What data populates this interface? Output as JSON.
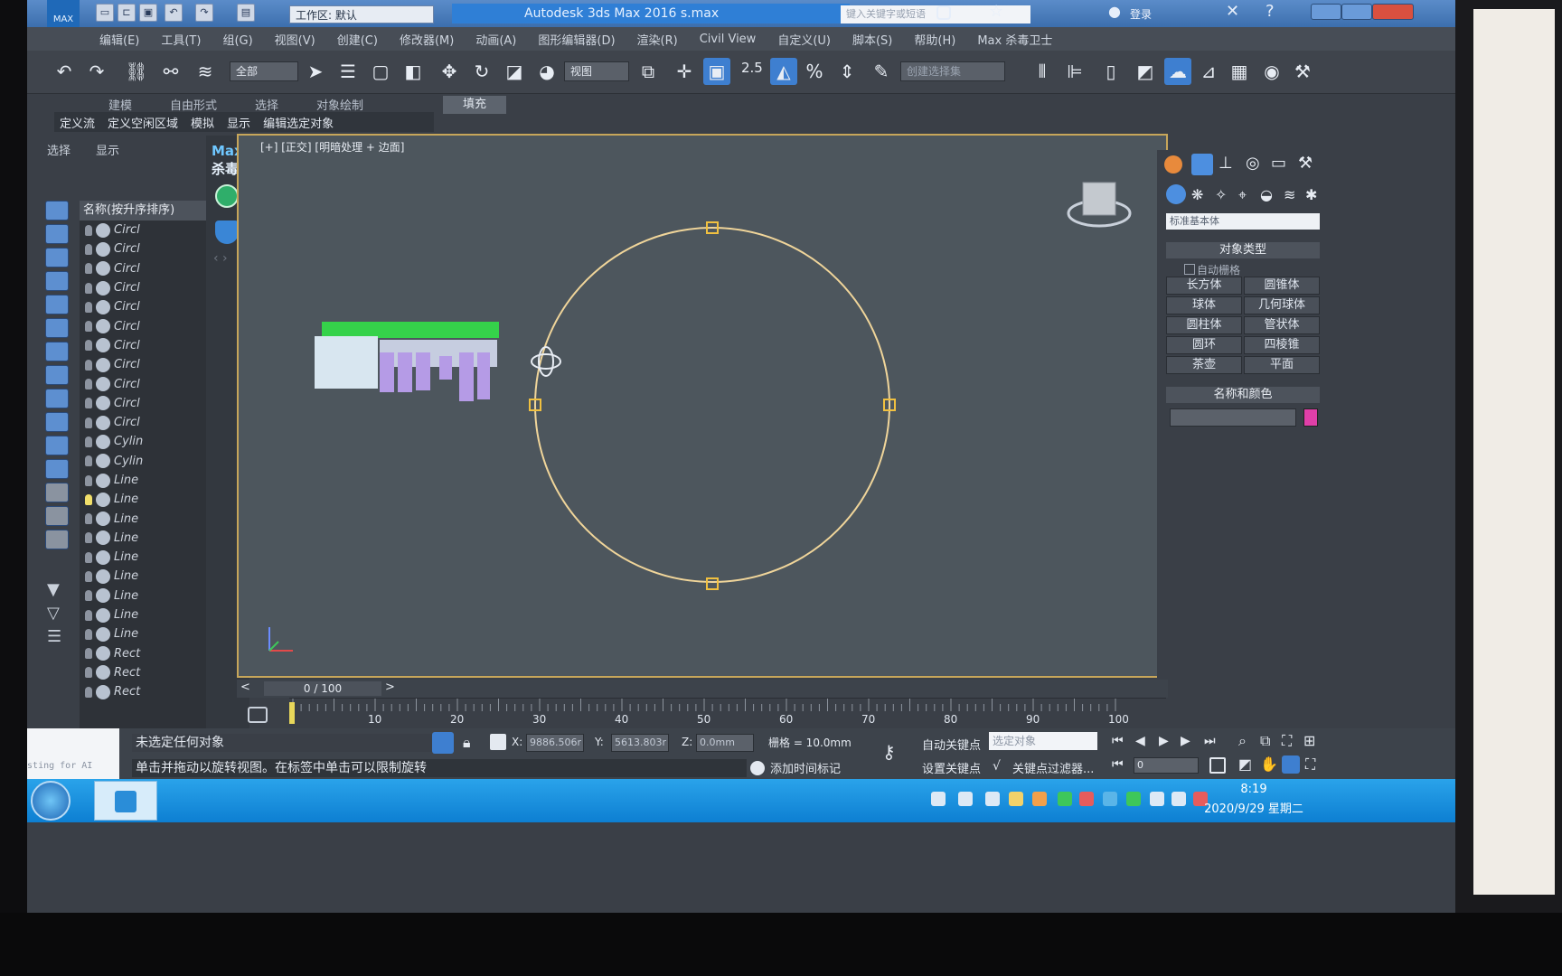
{
  "titlebar": {
    "workspace_label": "工作区: 默认",
    "title": "Autodesk 3ds Max 2016    s.max",
    "search_placeholder": "键入关键字或短语",
    "login": "登录"
  },
  "menu": [
    "编辑(E)",
    "工具(T)",
    "组(G)",
    "视图(V)",
    "创建(C)",
    "修改器(M)",
    "动画(A)",
    "图形编辑器(D)",
    "渲染(R)",
    "Civil View",
    "自定义(U)",
    "脚本(S)",
    "帮助(H)",
    "Max 杀毒卫士"
  ],
  "toolbar": {
    "selection_filter": "全部",
    "ref_coord": "视图",
    "snap_value": "2.5",
    "named_selection": "创建选择集"
  },
  "ribbon": {
    "tabs": [
      "建模",
      "自由形式",
      "选择",
      "对象绘制",
      "填充"
    ],
    "subtabs": [
      "定义流",
      "定义空闲区域",
      "模拟",
      "显示",
      "编辑选定对象"
    ]
  },
  "scene_explorer": {
    "tabs": [
      "选择",
      "显示"
    ],
    "header": "名称(按升序排序)",
    "items": [
      "Circl",
      "Circl",
      "Circl",
      "Circl",
      "Circl",
      "Circl",
      "Circl",
      "Circl",
      "Circl",
      "Circl",
      "Circl",
      "Cylin",
      "Cylin",
      "Line",
      "Line",
      "Line",
      "Line",
      "Line",
      "Line",
      "Line",
      "Line",
      "Line",
      "Rect",
      "Rect",
      "Rect"
    ]
  },
  "max_plugin": {
    "logo_line1": "Max",
    "logo_line2": "杀毒"
  },
  "viewport": {
    "label": "[+] [正交] [明暗处理 + 边面]"
  },
  "command_panel": {
    "dropdown": "标准基本体",
    "object_type_header": "对象类型",
    "autogrid": "自动栅格",
    "buttons": [
      "长方体",
      "圆锥体",
      "球体",
      "几何球体",
      "圆柱体",
      "管状体",
      "圆环",
      "四棱锥",
      "茶壶",
      "平面"
    ],
    "name_color_header": "名称和颜色",
    "object_color": "#e03fa8"
  },
  "timeline": {
    "frame_label": "0 / 100",
    "ticks": [
      "10",
      "20",
      "30",
      "40",
      "50",
      "60",
      "70",
      "80",
      "90",
      "100"
    ]
  },
  "status": {
    "maxscript_label": "Testing for AI",
    "selection_msg": "未选定任何对象",
    "prompt": "单击并拖动以旋转视图。在标签中单击可以限制旋转",
    "x_label": "X:",
    "x_value": "9886.506r",
    "y_label": "Y:",
    "y_value": "5613.803r",
    "z_label": "Z:",
    "z_value": "0.0mm",
    "grid": "栅格 = 10.0mm",
    "add_time_tag": "添加时间标记",
    "auto_key": "自动关键点",
    "set_key": "设置关键点",
    "selected_set": "选定对象",
    "key_filters": "关键点过滤器...",
    "frame_value": "0"
  },
  "taskbar": {
    "time": "8:19",
    "date": "2020/9/29 星期二"
  }
}
